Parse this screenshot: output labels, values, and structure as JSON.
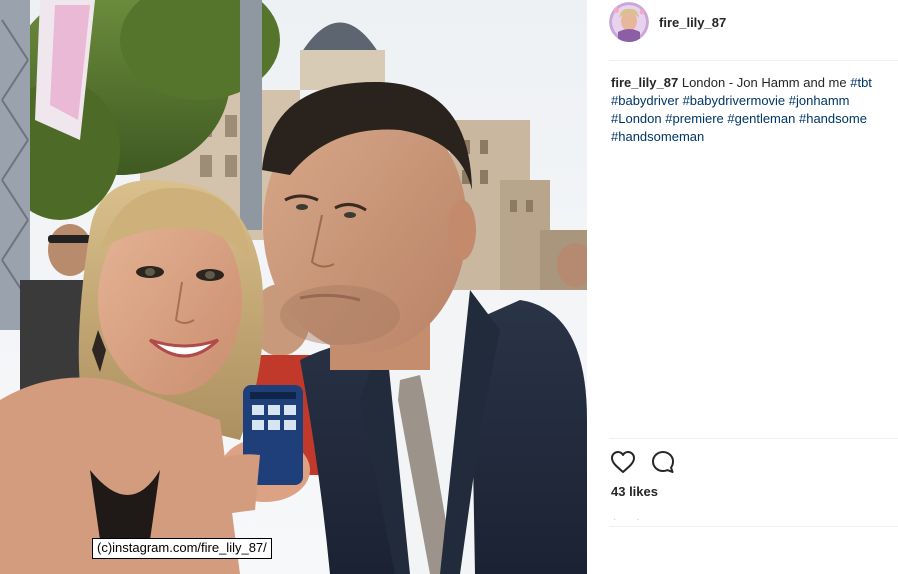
{
  "post": {
    "username": "fire_lily_87",
    "caption_text": "London - Jon Hamm and me",
    "hashtags": [
      "#tbt",
      "#babydriver",
      "#babydrivermovie",
      "#jonhamm",
      "#London",
      "#premiere",
      "#gentleman",
      "#handsome",
      "#handsomeman"
    ],
    "likes_text": "43 likes",
    "watermark": "(c)instagram.com/fire_lily_87/"
  },
  "icons": {
    "like": "heart-outline-icon",
    "comment": "speech-bubble-icon"
  },
  "colors": {
    "hashtag": "#003569",
    "text": "#262626",
    "divider": "#efefef"
  }
}
